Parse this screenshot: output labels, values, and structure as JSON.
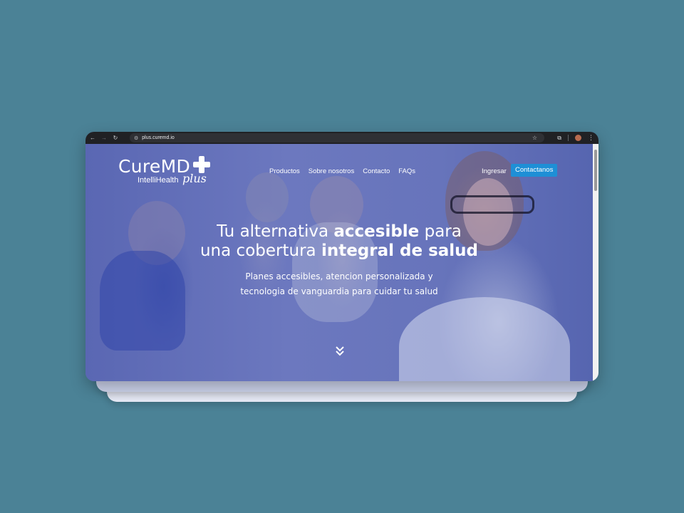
{
  "browser": {
    "url": "plus.curemd.io",
    "icons": [
      "back-arrow-icon",
      "forward-arrow-icon",
      "reload-icon",
      "site-settings-icon",
      "bookmark-star-icon",
      "extensions-icon",
      "profile-avatar",
      "kebab-menu-icon"
    ]
  },
  "site": {
    "logo": {
      "brand": "CureMD",
      "sub": "IntelliHealth",
      "plus": "plus"
    },
    "nav": [
      "Productos",
      "Sobre nosotros",
      "Contacto",
      "FAQs"
    ],
    "login": "Ingresar",
    "cta": "Contactanos",
    "hero": {
      "line1_pre": "Tu alternativa ",
      "line1_bold": "accesible",
      "line1_post": " para",
      "line2_pre": "una cobertura ",
      "line2_bold": "integral de salud",
      "sub1": "Planes accesibles, atencion personalizada y",
      "sub2": "tecnologia de vanguardia para cuidar tu salud"
    }
  },
  "colors": {
    "background": "#4b8296",
    "overlay": "#6270b8",
    "cta": "#1e8fd6",
    "chrome": "#202124"
  }
}
